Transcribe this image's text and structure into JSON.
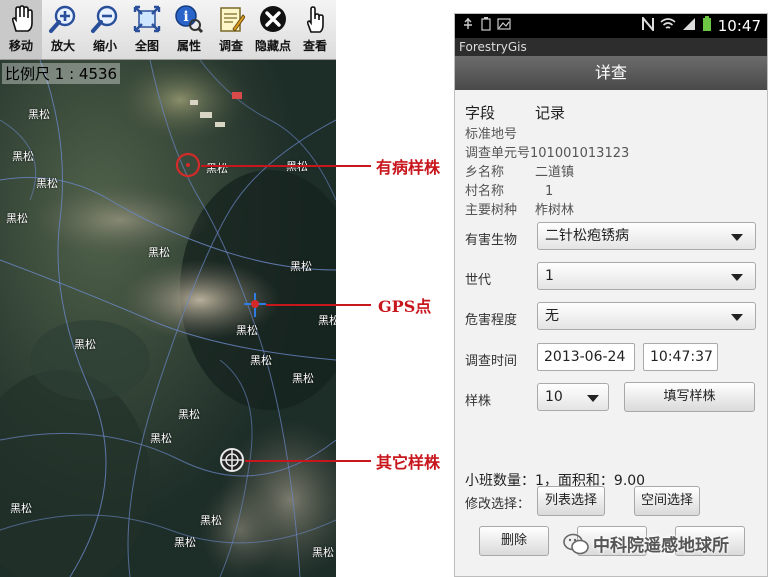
{
  "toolbar": {
    "tools": [
      {
        "label": "移动",
        "icon": "hand-icon"
      },
      {
        "label": "放大",
        "icon": "zoom-in-icon"
      },
      {
        "label": "缩小",
        "icon": "zoom-out-icon"
      },
      {
        "label": "全图",
        "icon": "full-extent-icon"
      },
      {
        "label": "属性",
        "icon": "identify-info-icon"
      },
      {
        "label": "调查",
        "icon": "survey-notepad-icon"
      },
      {
        "label": "隐藏点",
        "icon": "hide-points-icon"
      },
      {
        "label": "查看",
        "icon": "pointer-view-icon"
      }
    ]
  },
  "map": {
    "scale_text": "比例尺 1 : 4536",
    "labels": [
      "黑松",
      "黑松",
      "黑松",
      "黑松",
      "黑松",
      "黑松",
      "黑松",
      "黑松",
      "黑松",
      "黑松",
      "黑松",
      "黑松",
      "黑松",
      "黑松",
      "黑松",
      "黑松",
      "黑松",
      "黑松",
      "黑松"
    ]
  },
  "annotations": {
    "diseased": "有病样株",
    "gps": "GPS点",
    "other": "其它样株"
  },
  "phone": {
    "status_time": "10:47",
    "app_name": "ForestryGis",
    "header": "详查",
    "field_col": "字段",
    "record_col": "记录",
    "rows": [
      {
        "label": "标准地号",
        "value": ""
      },
      {
        "label": "调查单元号",
        "value": "101001013123"
      },
      {
        "label": "乡名称",
        "value": "二道镇"
      },
      {
        "label": "村名称",
        "value": "1"
      },
      {
        "label": "主要树种",
        "value": "柞树林"
      }
    ],
    "pest_label": "有害生物",
    "pest_value": "二针松疱锈病",
    "generation_label": "世代",
    "generation_value": "1",
    "damage_label": "危害程度",
    "damage_value": "无",
    "survey_time_label": "调查时间",
    "survey_date": "2013-06-24",
    "survey_clock": "10:47:37",
    "sample_label": "样株",
    "sample_value": "10",
    "fill_sample_btn": "填写样株",
    "summary": "小班数量：1，面积和：9.00",
    "modify_label": "修改选择：",
    "list_select_btn": "列表选择",
    "spatial_select_btn": "空间选择",
    "delete_btn": "删除"
  },
  "watermark": "中科院遥感地球所",
  "colors": {
    "annotation_red": "#c8161d",
    "marker_red": "#d42a2a",
    "gps_blue": "#2f7de1",
    "phone_header": "#555555"
  }
}
